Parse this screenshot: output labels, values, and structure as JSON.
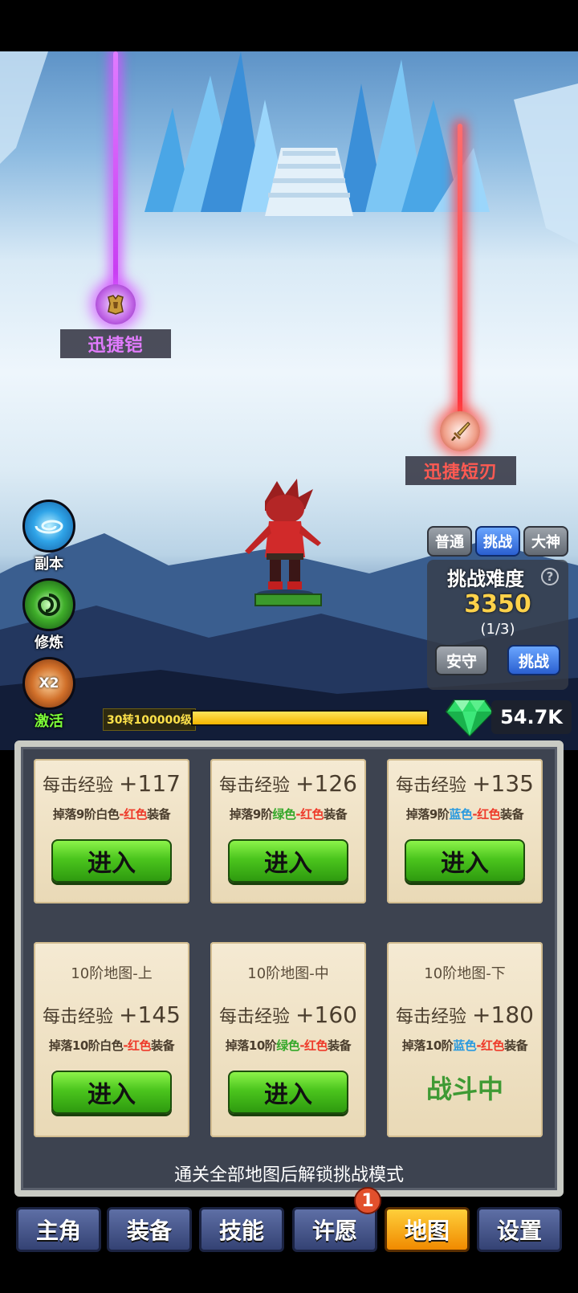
{
  "drops": {
    "left_item": "迅捷铠",
    "right_item": "迅捷短刃"
  },
  "side_menu": {
    "dungeon": "副本",
    "training": "修炼",
    "activate": "激活",
    "activate_badge": "X2"
  },
  "difficulty": {
    "tabs": {
      "normal": "普通",
      "challenge": "挑战",
      "god": "大神"
    },
    "active_tab": "挑战",
    "title": "挑战难度",
    "help": "?",
    "value": "3350",
    "progress": "(1/3)",
    "defend_label": "安守",
    "challenge_label": "挑战"
  },
  "player": {
    "level_text": "30转100000级",
    "xp_fraction": 1.0,
    "gems": "54.7K"
  },
  "maps": [
    {
      "title": "",
      "exp_label": "每击经验",
      "exp_value": "+117",
      "drop_prefix": "掉落9阶",
      "drop_from": "白色",
      "drop_from_color": "plain",
      "dash": "-",
      "drop_to": "红色",
      "drop_suffix": "装备",
      "action": "进入",
      "status": "enter"
    },
    {
      "title": "",
      "exp_label": "每击经验",
      "exp_value": "+126",
      "drop_prefix": "掉落9阶",
      "drop_from": "绿色",
      "drop_from_color": "green",
      "dash": "-",
      "drop_to": "红色",
      "drop_suffix": "装备",
      "action": "进入",
      "status": "enter"
    },
    {
      "title": "",
      "exp_label": "每击经验",
      "exp_value": "+135",
      "drop_prefix": "掉落9阶",
      "drop_from": "蓝色",
      "drop_from_color": "blue",
      "dash": "-",
      "drop_to": "红色",
      "drop_suffix": "装备",
      "action": "进入",
      "status": "enter"
    },
    {
      "title": "10阶地图-上",
      "exp_label": "每击经验",
      "exp_value": "+145",
      "drop_prefix": "掉落10阶",
      "drop_from": "白色",
      "drop_from_color": "plain",
      "dash": "-",
      "drop_to": "红色",
      "drop_suffix": "装备",
      "action": "进入",
      "status": "enter"
    },
    {
      "title": "10阶地图-中",
      "exp_label": "每击经验",
      "exp_value": "+160",
      "drop_prefix": "掉落10阶",
      "drop_from": "绿色",
      "drop_from_color": "green",
      "dash": "-",
      "drop_to": "红色",
      "drop_suffix": "装备",
      "action": "进入",
      "status": "enter"
    },
    {
      "title": "10阶地图-下",
      "exp_label": "每击经验",
      "exp_value": "+180",
      "drop_prefix": "掉落10阶",
      "drop_from": "蓝色",
      "drop_from_color": "blue",
      "dash": "-",
      "drop_to": "红色",
      "drop_suffix": "装备",
      "action": "战斗中",
      "status": "fighting"
    }
  ],
  "panel_note": "通关全部地图后解锁挑战模式",
  "nav": {
    "hero": "主角",
    "equipment": "装备",
    "skills": "技能",
    "wish": "许愿",
    "map": "地图",
    "settings": "设置",
    "active": "地图",
    "wish_badge": "1"
  },
  "colors": {
    "accent_gold": "#ffd24a",
    "green_button": "#4bc51d",
    "nav_active": "#f5a300",
    "item_purple": "#e27bff",
    "item_red": "#ff5a52"
  }
}
